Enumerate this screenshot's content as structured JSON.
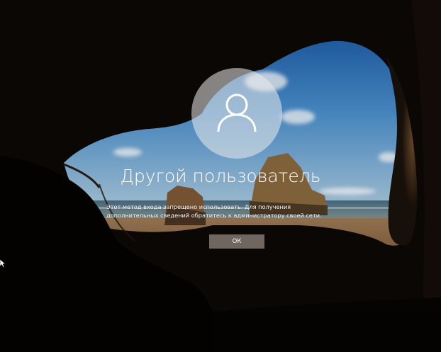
{
  "lock_screen": {
    "avatar_icon": "user-silhouette-icon",
    "username": "Другой пользователь",
    "message_lines": [
      "Этот метод входа запрещено использовать. Для получения",
      "дополнительных сведений обратитесь к администратору своей сети."
    ],
    "ok_label": "ОК"
  },
  "colors": {
    "cave": "#0b0806",
    "sky": "#3d7fc2",
    "sea": "#3a5d6e",
    "sand": "#7a5232",
    "avatar_bg": "#c9c9c9",
    "button_bg": "#968c82"
  }
}
